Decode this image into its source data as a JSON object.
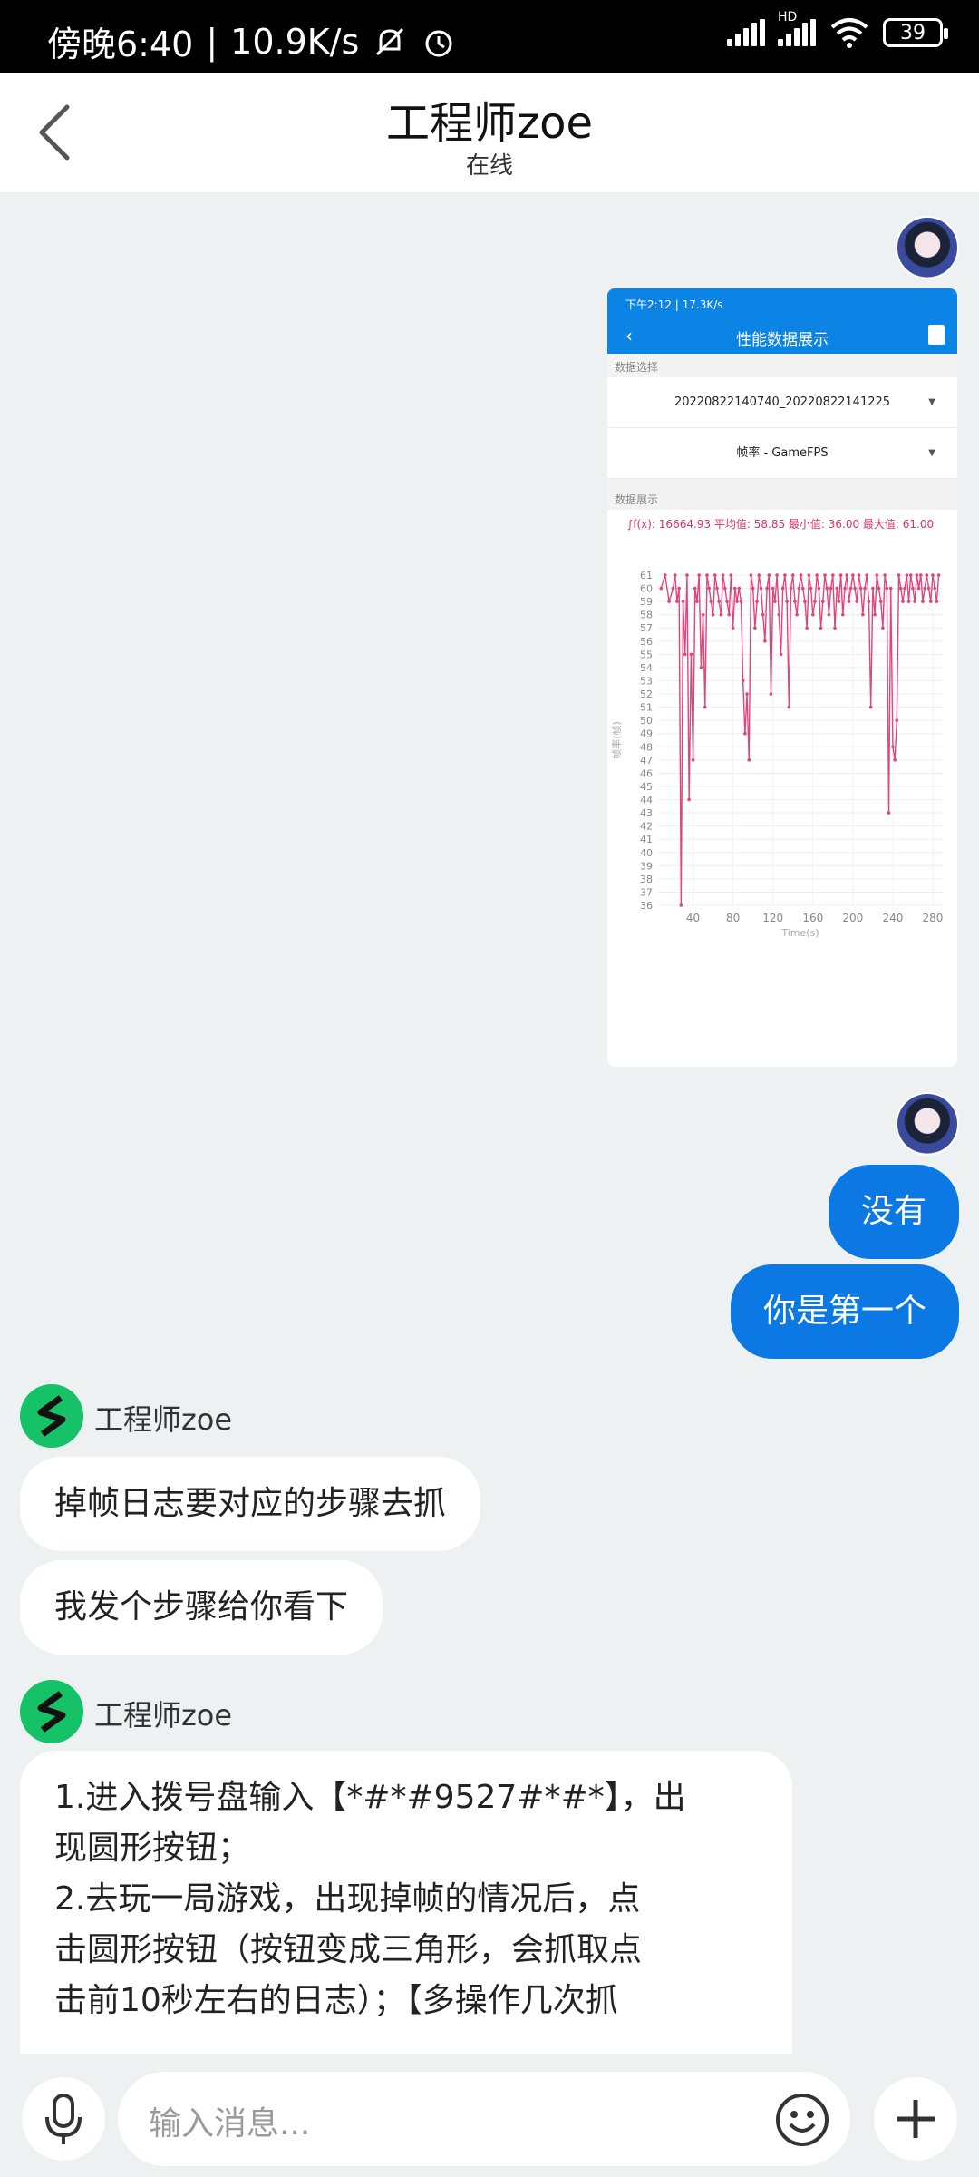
{
  "status_bar": {
    "time": "傍晚6:40",
    "speed": "10.9K/s",
    "network": "HD",
    "battery": "39"
  },
  "header": {
    "title": "工程师zoe",
    "status": "在线"
  },
  "screenshot": {
    "status_text": "下午2:12 | 17.3K/s",
    "title": "性能数据展示",
    "section_select": "数据选择",
    "file_value": "20220822140740_20220822141225",
    "metric_value": "帧率 - GameFPS",
    "section_show": "数据展示",
    "summary": "∫f(x): 16664.93  平均值: 58.85  最小值: 36.00  最大值: 61.00",
    "chart_data": {
      "type": "line",
      "xlabel": "Time(s)",
      "ylabel": "帧率(帧)",
      "xlim": [
        5,
        290
      ],
      "ylim": [
        36,
        61
      ],
      "x_ticks": [
        40,
        80,
        120,
        160,
        200,
        240,
        280
      ],
      "y_ticks": [
        36,
        37,
        38,
        39,
        40,
        41,
        42,
        43,
        44,
        45,
        46,
        47,
        48,
        49,
        50,
        51,
        52,
        53,
        54,
        55,
        56,
        57,
        58,
        59,
        60,
        61
      ],
      "color": "#e0457b",
      "series": [
        {
          "x": [
            8,
            12,
            16,
            20,
            22,
            24,
            26,
            28,
            30,
            32,
            34,
            36,
            38,
            40,
            42,
            44,
            46,
            48,
            50,
            52,
            54,
            56,
            58,
            60,
            62,
            64,
            66,
            68,
            70,
            72,
            74,
            76,
            78,
            80,
            82,
            84,
            86,
            88,
            90,
            92,
            94,
            96,
            98,
            100,
            102,
            104,
            106,
            108,
            110,
            112,
            114,
            116,
            118,
            120,
            122,
            124,
            126,
            128,
            130,
            132,
            134,
            136,
            138,
            140,
            142,
            144,
            146,
            148,
            150,
            152,
            154,
            156,
            158,
            160,
            162,
            164,
            166,
            168,
            170,
            172,
            174,
            176,
            178,
            180,
            182,
            184,
            186,
            188,
            190,
            192,
            194,
            196,
            198,
            200,
            202,
            204,
            206,
            208,
            210,
            212,
            214,
            216,
            218,
            220,
            222,
            224,
            226,
            228,
            230,
            232,
            234,
            236,
            238,
            240,
            242,
            244,
            246,
            248,
            250,
            252,
            254,
            256,
            258,
            260,
            262,
            264,
            266,
            268,
            270,
            272,
            274,
            276,
            278,
            280,
            282,
            284,
            286
          ],
          "y": [
            60,
            61,
            59,
            60,
            61,
            59,
            60,
            36,
            59,
            55,
            61,
            44,
            55,
            47,
            60,
            59,
            61,
            54,
            58,
            51,
            61,
            60,
            59,
            58,
            61,
            60,
            59,
            58,
            61,
            60,
            59,
            58,
            61,
            57,
            60,
            59,
            60,
            59,
            53,
            49,
            52,
            47,
            61,
            60,
            57,
            59,
            61,
            60,
            58,
            56,
            60,
            61,
            52,
            60,
            59,
            61,
            58,
            55,
            60,
            61,
            59,
            51,
            60,
            61,
            59,
            58,
            60,
            61,
            60,
            59,
            57,
            61,
            60,
            58,
            59,
            61,
            60,
            57,
            59,
            61,
            60,
            58,
            60,
            61,
            57,
            60,
            59,
            61,
            58,
            60,
            61,
            59,
            60,
            61,
            60,
            59,
            61,
            60,
            58,
            60,
            61,
            59,
            51,
            60,
            58,
            61,
            60,
            59,
            57,
            61,
            60,
            43,
            60,
            48,
            47,
            50,
            61,
            60,
            59,
            60,
            61,
            59,
            61,
            60,
            59,
            61,
            60,
            61,
            59,
            60,
            61,
            60,
            59,
            61,
            60,
            59,
            61,
            60
          ]
        }
      ]
    }
  },
  "messages": {
    "out1": "没有",
    "out2": "你是第一个",
    "sender1": "工程师zoe",
    "in1": "掉帧日志要对应的步骤去抓",
    "in2": "我发个步骤给你看下",
    "sender2": "工程师zoe",
    "long_lines": [
      "1.进入拨号盘输入【*#*#9527#*#*】，出",
      "现圆形按钮；",
      "2.去玩一局游戏，出现掉帧的情况后，点",
      "击圆形按钮（按钮变成三角形，会抓取点",
      "击前10秒左右的日志）；【多操作几次抓"
    ]
  },
  "input": {
    "placeholder": "输入消息..."
  }
}
